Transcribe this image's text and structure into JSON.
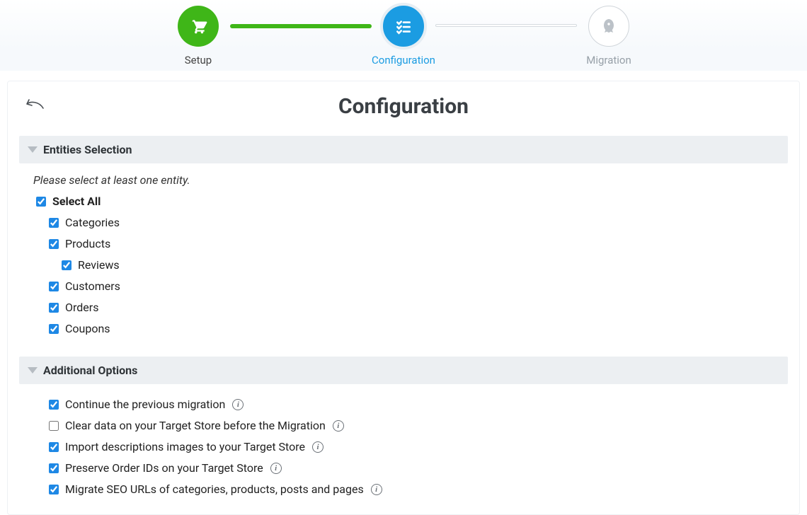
{
  "stepper": {
    "steps": [
      {
        "label": "Setup",
        "state": "done",
        "icon": "cart-icon"
      },
      {
        "label": "Configuration",
        "state": "active",
        "icon": "list-icon"
      },
      {
        "label": "Migration",
        "state": "idle",
        "icon": "rocket-icon"
      }
    ]
  },
  "page": {
    "title": "Configuration"
  },
  "entities": {
    "section_title": "Entities Selection",
    "hint": "Please select at least one entity.",
    "select_all": {
      "label": "Select All",
      "checked": true
    },
    "items": [
      {
        "label": "Categories",
        "checked": true,
        "indent": 1
      },
      {
        "label": "Products",
        "checked": true,
        "indent": 1
      },
      {
        "label": "Reviews",
        "checked": true,
        "indent": 2
      },
      {
        "label": "Customers",
        "checked": true,
        "indent": 1
      },
      {
        "label": "Orders",
        "checked": true,
        "indent": 1
      },
      {
        "label": "Coupons",
        "checked": true,
        "indent": 1
      }
    ]
  },
  "options": {
    "section_title": "Additional Options",
    "items": [
      {
        "label": "Continue the previous migration",
        "checked": true,
        "info": true
      },
      {
        "label": "Clear data on your Target Store before the Migration",
        "checked": false,
        "info": true
      },
      {
        "label": "Import descriptions images to your Target Store",
        "checked": true,
        "info": true
      },
      {
        "label": "Preserve Order IDs on your Target Store",
        "checked": true,
        "info": true
      },
      {
        "label": "Migrate SEO URLs of categories, products, posts and pages",
        "checked": true,
        "info": true
      }
    ]
  }
}
